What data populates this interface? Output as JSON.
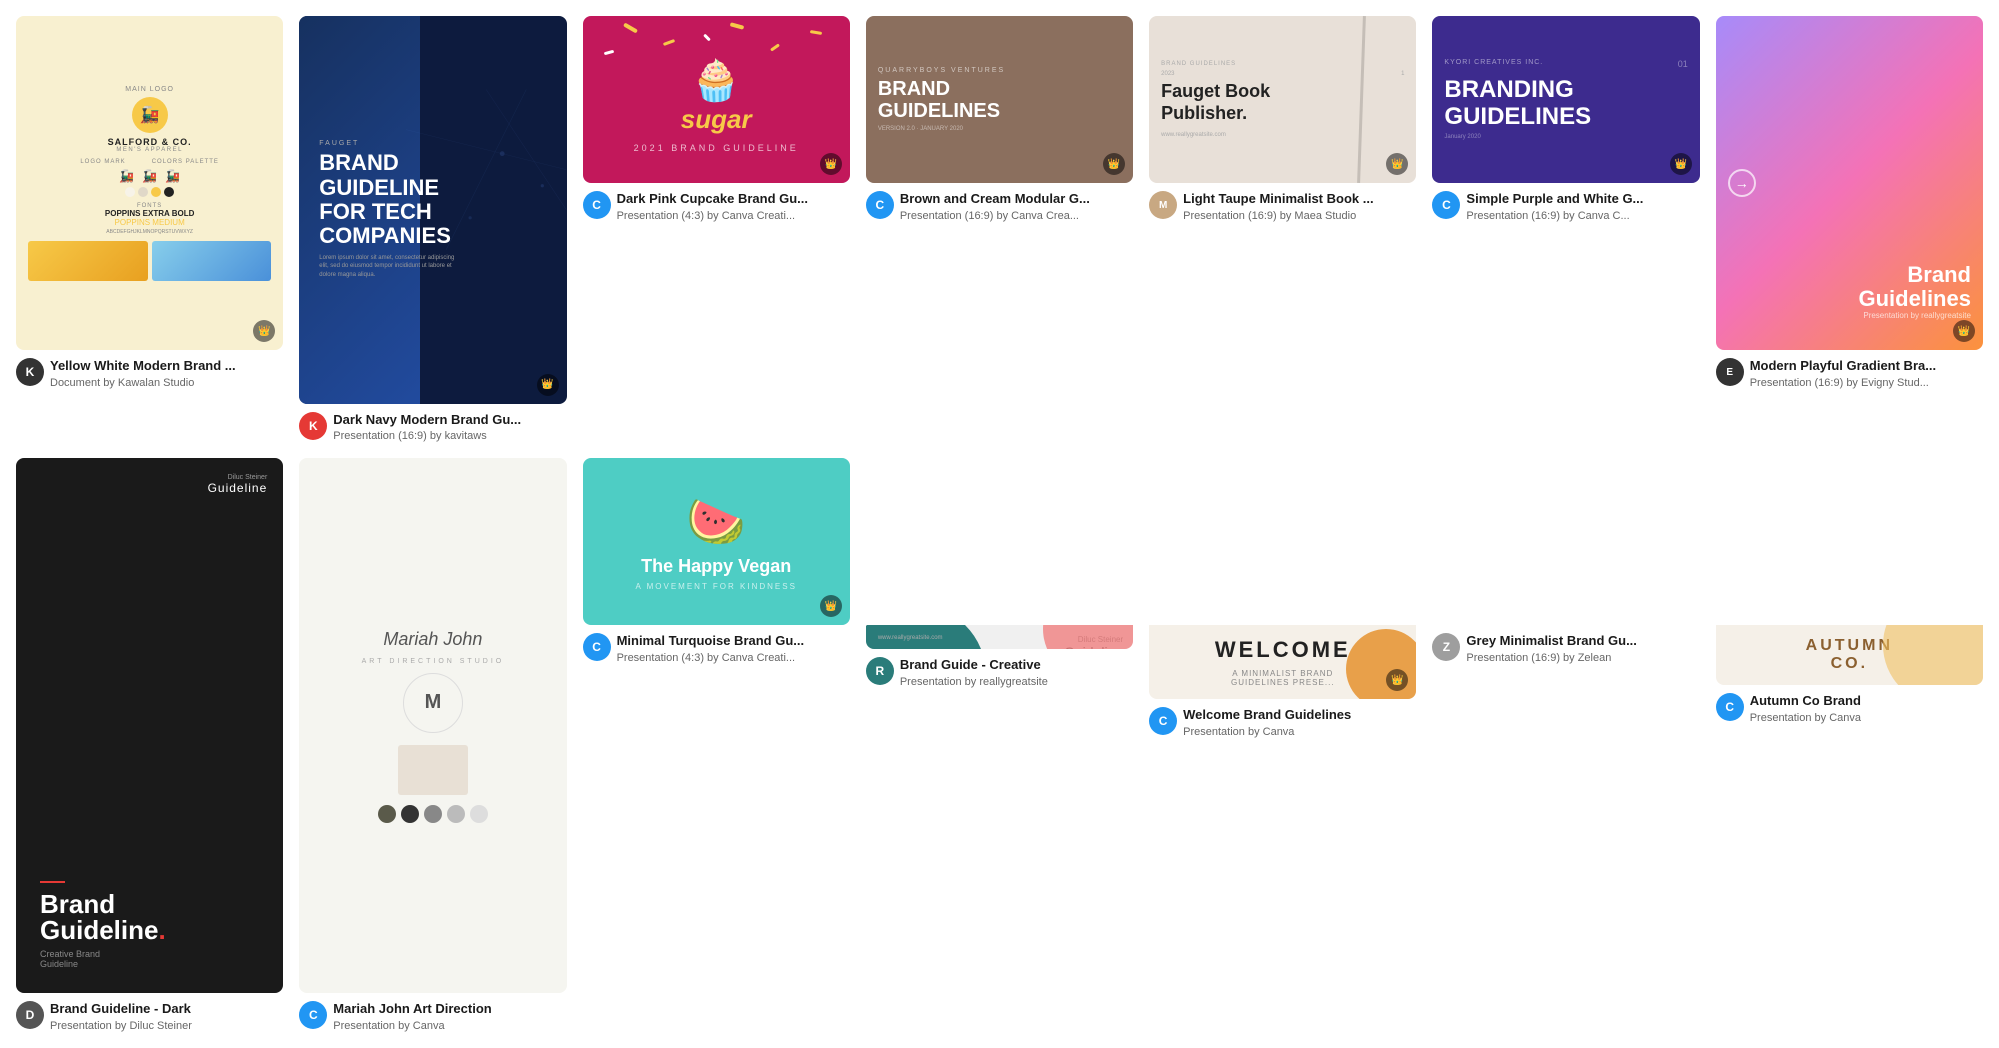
{
  "cards": [
    {
      "id": "yellow-white-modern",
      "title": "Yellow White Modern Brand ...",
      "subtitle": "Document by Kawalan Studio",
      "avatar_color": "#222",
      "avatar_letter": "K",
      "thumb_type": "landscape",
      "thumb_style": "salford"
    },
    {
      "id": "dark-navy-brand",
      "title": "Dark Navy Modern Brand Gu...",
      "subtitle": "Presentation (16:9) by kavitaws",
      "avatar_color": "#e53935",
      "avatar_letter": "K",
      "thumb_type": "landscape",
      "thumb_style": "navy"
    },
    {
      "id": "dark-pink-cupcake",
      "title": "Dark Pink Cupcake Brand Gu...",
      "subtitle": "Presentation (4:3) by Canva Creati...",
      "avatar_color": "#2196f3",
      "avatar_letter": "C",
      "thumb_type": "landscape",
      "thumb_style": "cupcake"
    },
    {
      "id": "brown-cream-modular",
      "title": "Brown and Cream Modular G...",
      "subtitle": "Presentation (16:9) by Canva Crea...",
      "avatar_color": "#2196f3",
      "avatar_letter": "C",
      "thumb_type": "landscape",
      "thumb_style": "brown"
    },
    {
      "id": "light-taupe-book",
      "title": "Light Taupe Minimalist Book ...",
      "subtitle": "Presentation (16:9) by Maea Studio",
      "avatar_color": "#c8a882",
      "avatar_letter": "M",
      "thumb_type": "landscape",
      "thumb_style": "taupe"
    },
    {
      "id": "simple-purple",
      "title": "Simple Purple and White G...",
      "subtitle": "Presentation (16:9) by Canva C...",
      "avatar_color": "#2196f3",
      "avatar_letter": "C",
      "thumb_type": "landscape",
      "thumb_style": "purple"
    },
    {
      "id": "modern-playful-gradient",
      "title": "Modern Playful Gradient Bra...",
      "subtitle": "Presentation (16:9) by Evigny Stud...",
      "avatar_color": "#333",
      "avatar_letter": "E",
      "thumb_type": "landscape",
      "thumb_style": "gradient"
    },
    {
      "id": "black-guideline",
      "title": "Brand Guideline - Dark",
      "subtitle": "Presentation by Diluc Steiner",
      "avatar_color": "#333",
      "avatar_letter": "D",
      "thumb_type": "portrait",
      "thumb_style": "black"
    },
    {
      "id": "mariah-john",
      "title": "Mariah John Art Direction",
      "subtitle": "Presentation by Canva",
      "avatar_color": "#2196f3",
      "avatar_letter": "C",
      "thumb_type": "portrait",
      "thumb_style": "mariah"
    },
    {
      "id": "minimal-turquoise",
      "title": "Minimal Turquoise Brand Gu...",
      "subtitle": "Presentation (4:3) by Canva Creati...",
      "avatar_color": "#2196f3",
      "avatar_letter": "C",
      "thumb_type": "landscape",
      "thumb_style": "vegan"
    },
    {
      "id": "teal-brand-guide",
      "title": "Brand Guide - Creative",
      "subtitle": "Presentation by reallygreatsite",
      "avatar_color": "#2a7c7a",
      "avatar_letter": "R",
      "thumb_type": "landscape",
      "thumb_style": "teal"
    },
    {
      "id": "welcome-brand",
      "title": "Welcome Brand Guidelines",
      "subtitle": "Presentation by Canva",
      "avatar_color": "#2196f3",
      "avatar_letter": "C",
      "thumb_type": "landscape",
      "thumb_style": "welcome"
    },
    {
      "id": "grey-minimalist",
      "title": "Grey Minimalist Brand Gu...",
      "subtitle": "Presentation (16:9) by Zelean",
      "avatar_color": "#9e9e9e",
      "avatar_letter": "Z",
      "thumb_type": "landscape",
      "thumb_style": "grey-min"
    },
    {
      "id": "autumn-co",
      "title": "Autumn Co Brand",
      "subtitle": "Presentation by Canva",
      "avatar_color": "#2196f3",
      "avatar_letter": "C",
      "thumb_type": "landscape",
      "thumb_style": "autumn"
    }
  ]
}
